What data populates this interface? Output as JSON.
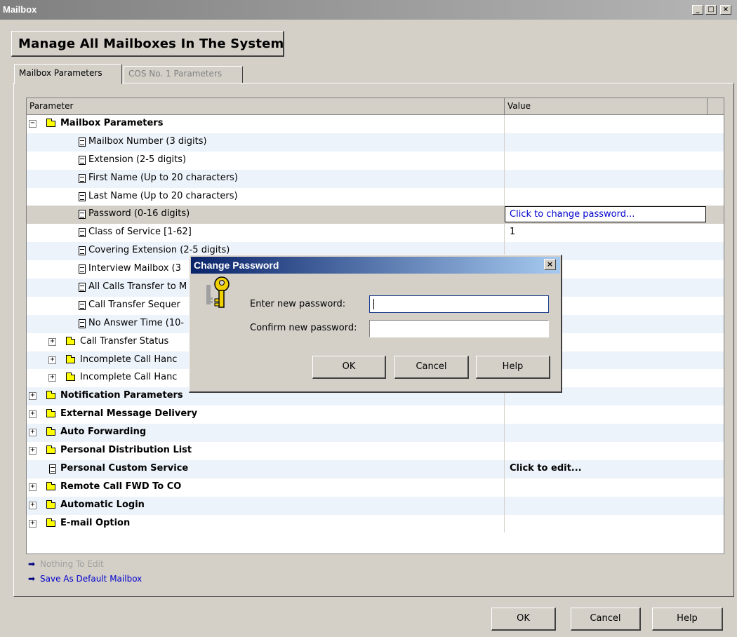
{
  "window": {
    "title": "Mailbox",
    "controls": {
      "minimize": "_",
      "maximize": "□",
      "close": "×"
    }
  },
  "header": {
    "title": "Manage All Mailboxes In The System"
  },
  "tabs": [
    {
      "label": "Mailbox Parameters",
      "active": true
    },
    {
      "label": "COS No. 1 Parameters",
      "active": false
    }
  ],
  "grid": {
    "columns": {
      "parameter": "Parameter",
      "value": "Value"
    },
    "rows": [
      {
        "label": "Mailbox Parameters",
        "value": "",
        "level": 0,
        "node": "folder",
        "expander": "−",
        "bold": true
      },
      {
        "label": "Mailbox Number (3 digits)",
        "value": "",
        "level": 2,
        "node": "doc",
        "bold": false
      },
      {
        "label": "Extension (2-5 digits)",
        "value": "",
        "level": 2,
        "node": "doc",
        "bold": false
      },
      {
        "label": "First Name (Up to 20 characters)",
        "value": "",
        "level": 2,
        "node": "doc",
        "bold": false
      },
      {
        "label": "Last Name (Up to 20 characters)",
        "value": "",
        "level": 2,
        "node": "doc",
        "bold": false
      },
      {
        "label": "Password (0-16 digits)",
        "value": "Click to change password...",
        "level": 2,
        "node": "doc",
        "bold": false,
        "selected": true
      },
      {
        "label": "Class of Service [1-62]",
        "value": "1",
        "level": 2,
        "node": "doc",
        "bold": false
      },
      {
        "label": "Covering Extension (2-5 digits)",
        "value": "",
        "level": 2,
        "node": "doc",
        "bold": false
      },
      {
        "label": "Interview Mailbox (3",
        "value": "",
        "level": 2,
        "node": "doc",
        "bold": false
      },
      {
        "label": "All Calls Transfer to M",
        "value": "",
        "level": 2,
        "node": "doc",
        "bold": false
      },
      {
        "label": "Call Transfer Sequer",
        "value": "",
        "level": 2,
        "node": "doc",
        "bold": false
      },
      {
        "label": "No Answer Time (10-",
        "value": "",
        "level": 2,
        "node": "doc",
        "bold": false
      },
      {
        "label": "Call Transfer Status",
        "value": "",
        "level": 1,
        "node": "folder",
        "expander": "+",
        "bold": false
      },
      {
        "label": "Incomplete Call Hanc",
        "value": "",
        "level": 1,
        "node": "folder",
        "expander": "+",
        "bold": false
      },
      {
        "label": "Incomplete Call Hanc",
        "value": "",
        "level": 1,
        "node": "folder",
        "expander": "+",
        "bold": false
      },
      {
        "label": "Notification Parameters",
        "value": "",
        "level": 0,
        "node": "folder",
        "expander": "+",
        "bold": true
      },
      {
        "label": "External Message Delivery",
        "value": "",
        "level": 0,
        "node": "folder",
        "expander": "+",
        "bold": true
      },
      {
        "label": "Auto Forwarding",
        "value": "",
        "level": 0,
        "node": "folder",
        "expander": "+",
        "bold": true
      },
      {
        "label": "Personal Distribution List",
        "value": "",
        "level": 0,
        "node": "folder",
        "expander": "+",
        "bold": true
      },
      {
        "label": "Personal Custom Service",
        "value": "Click to edit...",
        "level": 0,
        "node": "doc",
        "bold": true,
        "valueBold": true
      },
      {
        "label": "Remote Call FWD To CO",
        "value": "",
        "level": 0,
        "node": "folder",
        "expander": "+",
        "bold": true
      },
      {
        "label": "Automatic Login",
        "value": "",
        "level": 0,
        "node": "folder",
        "expander": "+",
        "bold": true
      },
      {
        "label": "E-mail Option",
        "value": "",
        "level": 0,
        "node": "folder",
        "expander": "+",
        "bold": true
      }
    ]
  },
  "links": [
    {
      "label": "Nothing To Edit",
      "enabled": false
    },
    {
      "label": "Save As Default Mailbox",
      "enabled": true
    }
  ],
  "buttons": {
    "ok": "OK",
    "cancel": "Cancel",
    "help": "Help"
  },
  "dialog": {
    "title": "Change Password",
    "close": "×",
    "icon": "keys-icon",
    "new_password_label": "Enter new password:",
    "confirm_password_label": "Confirm new password:",
    "new_password_value": "",
    "confirm_password_value": "",
    "ok": "OK",
    "cancel": "Cancel",
    "help": "Help"
  },
  "colors": {
    "stripe": "#edf3fa",
    "link": "#0000cc",
    "dialog_title_start": "#0a246a",
    "dialog_title_end": "#a6caf0",
    "folder": "#ffff00"
  }
}
